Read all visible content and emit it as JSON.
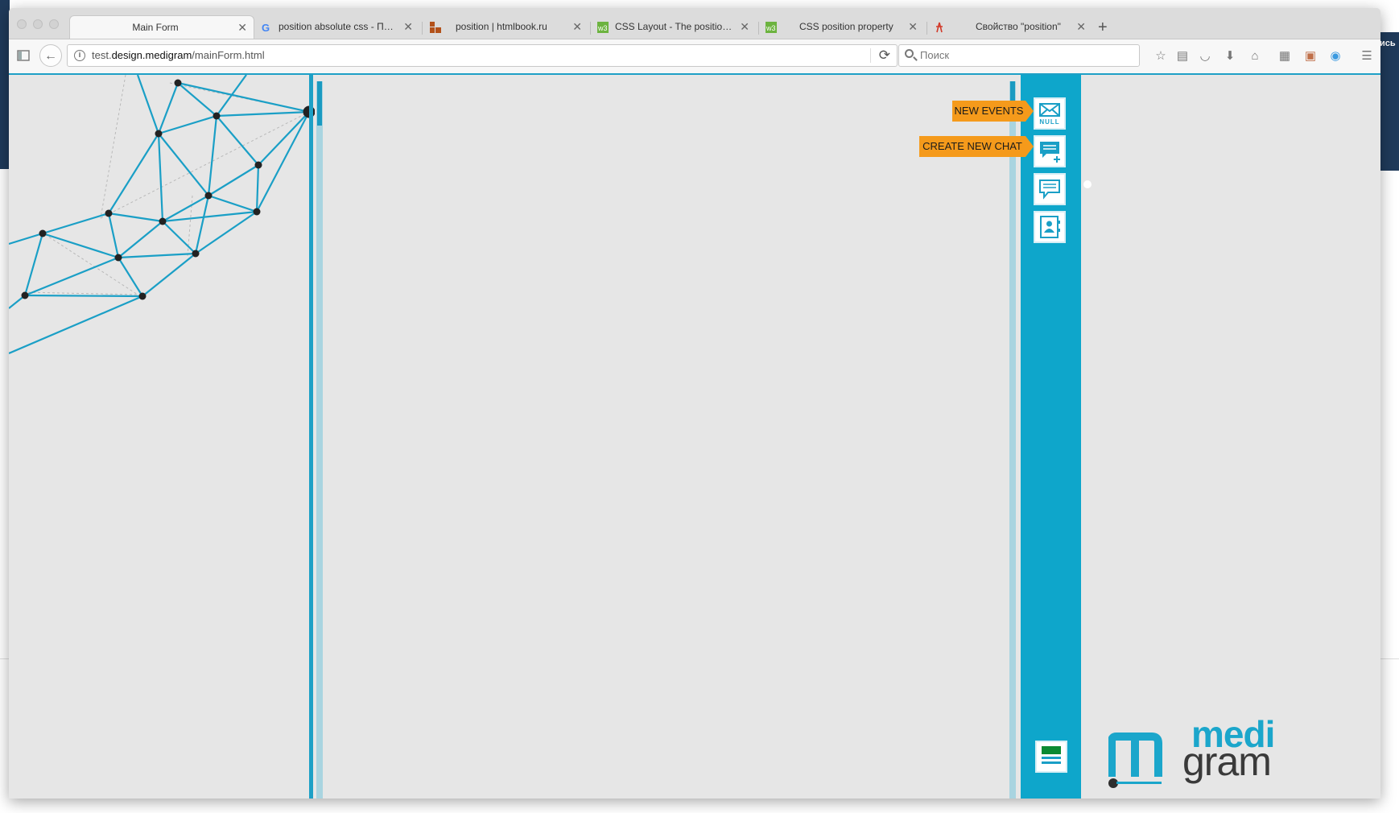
{
  "background": {
    "right_label": "ись"
  },
  "tabs": [
    {
      "label": "Main Form",
      "icon": "page-icon",
      "active": true
    },
    {
      "label": "position absolute css - Пои...",
      "icon": "google-icon",
      "active": false
    },
    {
      "label": "position | htmlbook.ru",
      "icon": "htmlbook-icon",
      "active": false
    },
    {
      "label": "CSS Layout - The position ...",
      "icon": "w3-icon",
      "active": false
    },
    {
      "label": "CSS position property",
      "icon": "w3-icon",
      "active": false
    },
    {
      "label": "Свойство \"position\"",
      "icon": "site-icon",
      "active": false
    }
  ],
  "navbar": {
    "url_host_prefix": "test.",
    "url_host": "design.medigram",
    "url_path": "/mainForm.html",
    "search_placeholder": "Поиск"
  },
  "sidebar": {
    "tooltips": {
      "new_events": "NEW EVENTS",
      "create_new_chat": "CREATE NEW CHAT"
    },
    "buttons": [
      {
        "name": "new-events-button",
        "icon": "mail-icon",
        "badge": "NULL"
      },
      {
        "name": "create-chat-button",
        "icon": "chat-add-icon"
      },
      {
        "name": "chats-button",
        "icon": "chat-icon"
      },
      {
        "name": "contacts-button",
        "icon": "contact-book-icon"
      }
    ]
  },
  "logo": {
    "line1": "medi",
    "line2": "gram"
  },
  "colors": {
    "accent": "#0ea6cb",
    "tooltip": "#f59a1b",
    "content_bg": "#e6e6e6"
  }
}
